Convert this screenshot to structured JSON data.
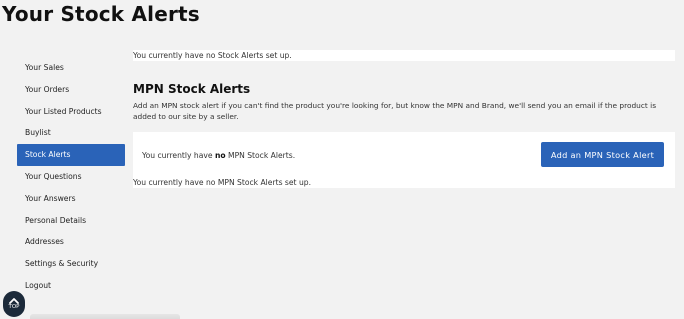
{
  "page": {
    "title": "Your Stock Alerts"
  },
  "sidebar": {
    "items": [
      {
        "label": "Your Sales"
      },
      {
        "label": "Your Orders"
      },
      {
        "label": "Your Listed Products"
      },
      {
        "label": "Buylist"
      },
      {
        "label": "Stock Alerts",
        "active": true
      },
      {
        "label": "Your Questions"
      },
      {
        "label": "Your Answers"
      },
      {
        "label": "Personal Details"
      },
      {
        "label": "Addresses"
      },
      {
        "label": "Settings & Security"
      },
      {
        "label": "Logout"
      }
    ]
  },
  "stock_alerts": {
    "empty_message": "You currently have no Stock Alerts set up."
  },
  "mpn": {
    "heading": "MPN Stock Alerts",
    "description": "Add an MPN stock alert if you can't find the product you're looking for, but know the MPN and Brand, we'll send you an email if the product is added to our site by a seller.",
    "status_prefix": "You currently have",
    "status_emphasis": "no",
    "status_suffix": "MPN Stock Alerts.",
    "add_button_label": "Add an MPN Stock Alert",
    "empty_message": "You currently have no MPN Stock Alerts set up."
  },
  "scroll_top": {
    "label": "TOP",
    "icon": "chevron-up-icon"
  },
  "colors": {
    "accent": "#2a63b8",
    "background": "#f2f2f2",
    "top_button": "#1c2a3a"
  }
}
